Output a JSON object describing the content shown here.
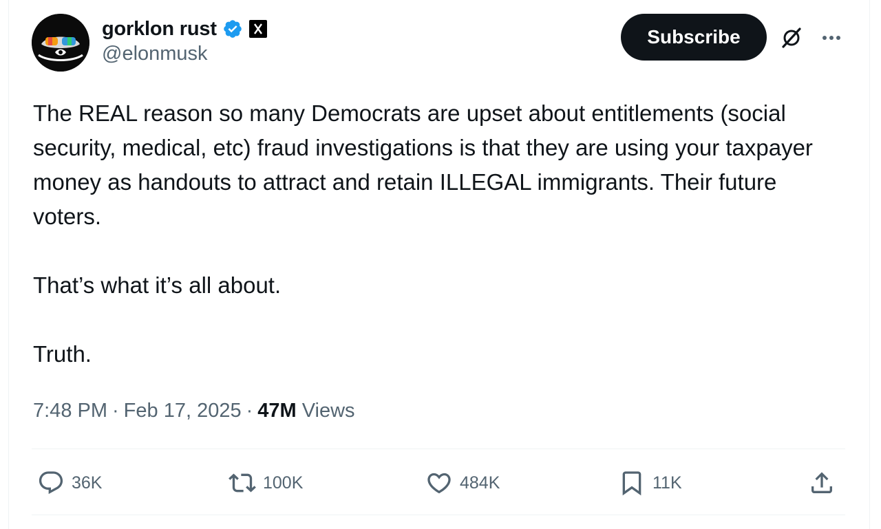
{
  "author": {
    "display_name": "gorklon rust",
    "handle": "@elonmusk",
    "verified_icon": "verified-badge-icon",
    "affiliate_icon": "x-affiliate-badge-icon",
    "avatar_icon": "goggles-avatar"
  },
  "header": {
    "subscribe_label": "Subscribe",
    "grok_icon": "grok-icon",
    "more_icon": "more-icon"
  },
  "tweet": {
    "paragraphs": [
      "The REAL reason so many Democrats are upset about entitlements (social security, medical, etc) fraud investigations is that they are using your taxpayer money as handouts to attract and retain ILLEGAL immigrants. Their future voters.",
      "That’s what it’s all about.",
      "Truth."
    ]
  },
  "meta": {
    "time": "7:48 PM",
    "separator": "·",
    "date": "Feb 17, 2025",
    "views_count": "47M",
    "views_label": "Views"
  },
  "actions": {
    "replies": "36K",
    "reposts": "100K",
    "likes": "484K",
    "bookmarks": "11K"
  },
  "colors": {
    "text": "#0f1419",
    "secondary": "#536471",
    "verified": "#1d9bf0",
    "border": "#eff3f4"
  }
}
